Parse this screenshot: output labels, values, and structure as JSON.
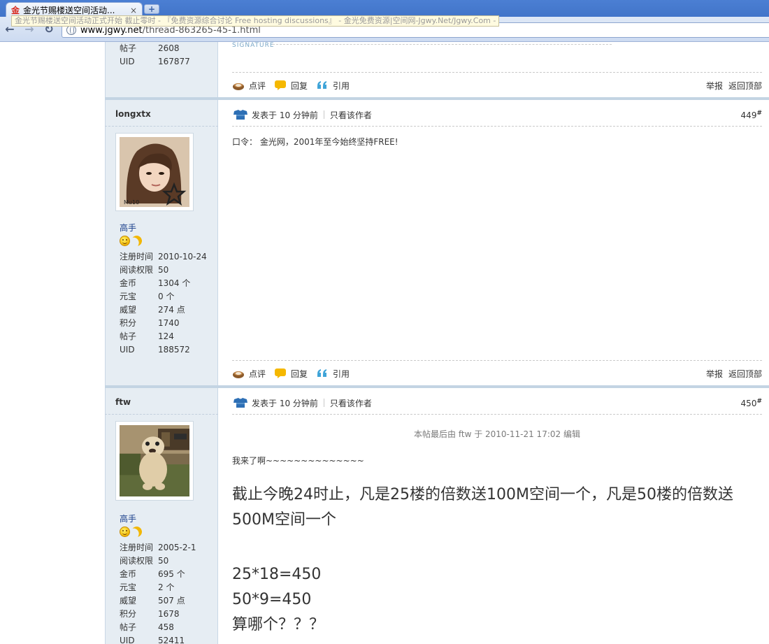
{
  "browser": {
    "tab_title": "金光节赐楼送空间活动...",
    "tab_close": "×",
    "new_tab": "+",
    "url_host": "www.jgwy.net",
    "url_path": "/thread-863265-45-1.html",
    "tooltip": "金光节赐楼送空间活动正式开始 截止零时 - 『免费资源综合讨论 Free hosting discussions』 - 金光免费资源|空间网-Jgwy.Net/Jgwy.Com -",
    "back_icon": "←",
    "forward_icon": "→",
    "reload_icon": "↻"
  },
  "top_user": {
    "stats": [
      {
        "k": "帖子",
        "v": "2608"
      },
      {
        "k": "UID",
        "v": "167877"
      }
    ],
    "signature": "SIGNATURE"
  },
  "actions": {
    "comment": "点评",
    "reply": "回复",
    "quote": "引用",
    "report": "举报",
    "top": "返回顶部"
  },
  "posts": [
    {
      "username": "longxtx",
      "rank": "高手",
      "posted": "发表于 10 分钟前",
      "author_only": "只看该作者",
      "floor": "449",
      "floor_mark": "#",
      "body": "口令： 金光网，2001年至今始终坚持FREE!",
      "stats": [
        {
          "k": "注册时间",
          "v": "2010-10-24"
        },
        {
          "k": "阅读权限",
          "v": "50"
        },
        {
          "k": "金币",
          "v": "1304 个"
        },
        {
          "k": "元宝",
          "v": "0 个"
        },
        {
          "k": "威望",
          "v": "274 点"
        },
        {
          "k": "积分",
          "v": "1740"
        },
        {
          "k": "帖子",
          "v": "124"
        },
        {
          "k": "UID",
          "v": "188572"
        }
      ]
    },
    {
      "username": "ftw",
      "rank": "高手",
      "posted": "发表于 10 分钟前",
      "author_only": "只看该作者",
      "floor": "450",
      "floor_mark": "#",
      "edit_note": "本帖最后由 ftw 于 2010-11-21 17:02 编辑",
      "line1": "我来了啊~~~~~~~~~~~~~~",
      "big1": "截止今晚24时止，凡是25楼的倍数送100M空间一个，凡是50楼的倍数送500M空间一个",
      "big2": "25*18=450",
      "big3": "50*9=450",
      "big4": "算哪个？？？",
      "stats": [
        {
          "k": "注册时间",
          "v": "2005-2-1"
        },
        {
          "k": "阅读权限",
          "v": "50"
        },
        {
          "k": "金币",
          "v": "695 个"
        },
        {
          "k": "元宝",
          "v": "2 个"
        },
        {
          "k": "威望",
          "v": "507 点"
        },
        {
          "k": "积分",
          "v": "1678"
        },
        {
          "k": "帖子",
          "v": "458"
        },
        {
          "k": "UID",
          "v": "52411"
        }
      ]
    }
  ]
}
